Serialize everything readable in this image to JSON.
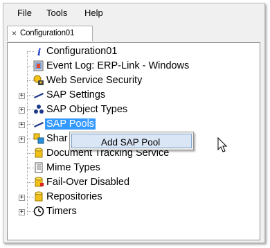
{
  "menu": {
    "items": [
      "File",
      "Tools",
      "Help"
    ]
  },
  "tabs": [
    {
      "label": "Configuration01",
      "close_glyph": "×"
    }
  ],
  "tree": {
    "items": [
      {
        "label": "Configuration01",
        "icon": "info-icon"
      },
      {
        "label": "Event Log: ERP-Link - Windows",
        "icon": "event-log-icon"
      },
      {
        "label": "Web Service Security",
        "icon": "security-icon"
      },
      {
        "label": "SAP Settings",
        "icon": "pen-icon"
      },
      {
        "label": "SAP Object Types",
        "icon": "object-types-icon"
      },
      {
        "label": "SAP Pools",
        "icon": "pen-icon"
      },
      {
        "label": "Shar",
        "icon": "share-icon"
      },
      {
        "label": "Document Tracking Service",
        "icon": "database-icon"
      },
      {
        "label": "Mime Types",
        "icon": "document-icon"
      },
      {
        "label": "Fail-Over Disabled",
        "icon": "database-icon"
      },
      {
        "label": "Repositories",
        "icon": "database-icon"
      },
      {
        "label": "Timers",
        "icon": "clock-icon"
      }
    ]
  },
  "context_menu": {
    "items": [
      "Add SAP Pool"
    ]
  },
  "colors": {
    "selection": "#3399ff",
    "menu_hover": "#dae6f6"
  }
}
